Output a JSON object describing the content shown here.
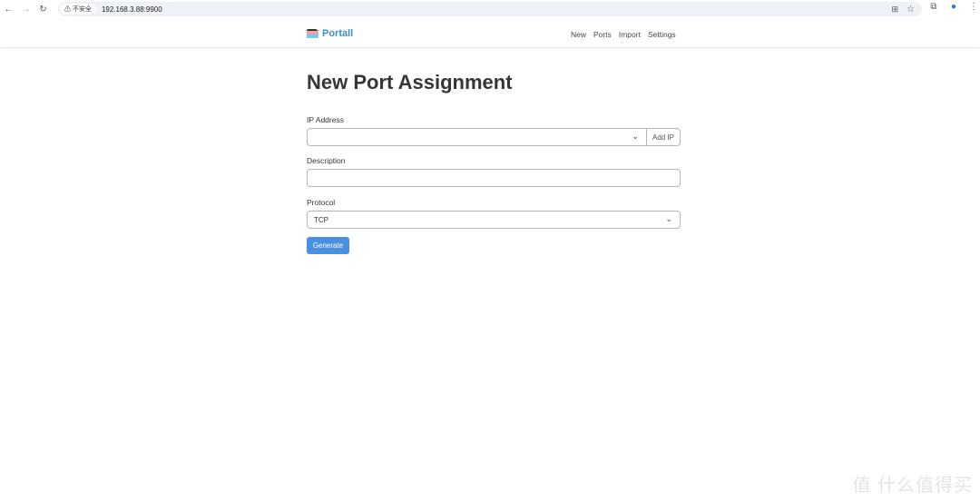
{
  "browser": {
    "security_label": "不安全",
    "url": "192.168.3.88:9900"
  },
  "app": {
    "brand": "Portall",
    "nav": [
      "New",
      "Ports",
      "Import",
      "Settings"
    ]
  },
  "page": {
    "title": "New Port Assignment",
    "ip_label": "IP Address",
    "ip_value": "",
    "add_ip": "Add IP",
    "description_label": "Description",
    "description_value": "",
    "protocol_label": "Protocol",
    "protocol_value": "TCP",
    "generate": "Generate"
  },
  "watermark": "值 什么值得买"
}
